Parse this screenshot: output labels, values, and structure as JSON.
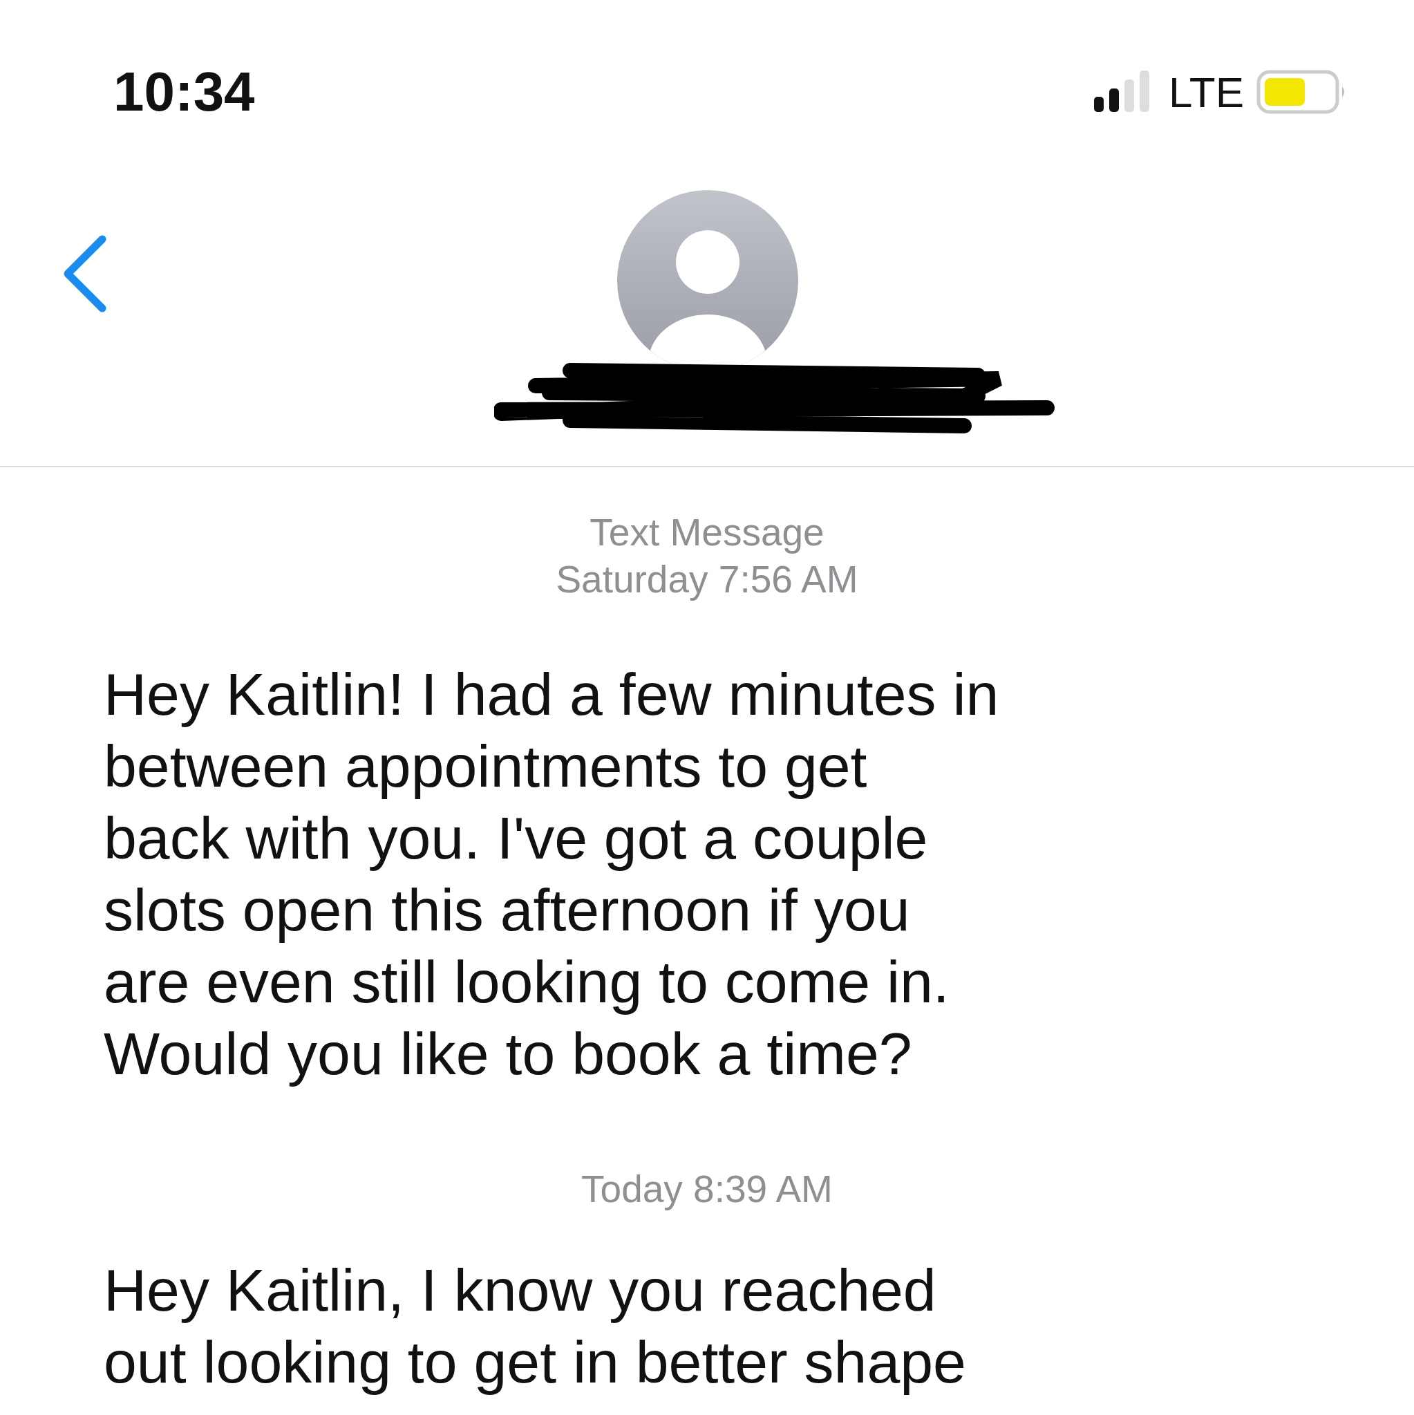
{
  "status_bar": {
    "time": "10:34",
    "network": "LTE"
  },
  "thread": [
    {
      "kind": "timestamp",
      "label": "Text Message",
      "time": "Saturday 7:56 AM"
    },
    {
      "kind": "message",
      "text": "Hey Kaitlin! I had a few minutes in between appointments to get back with you. I've got a couple slots open this afternoon if you are even still looking to come in. Would you like to book a time?"
    },
    {
      "kind": "timestamp",
      "time": "Today 8:39 AM"
    },
    {
      "kind": "message",
      "text": "Hey Kaitlin, I know you reached out looking to get in better shape"
    }
  ]
}
